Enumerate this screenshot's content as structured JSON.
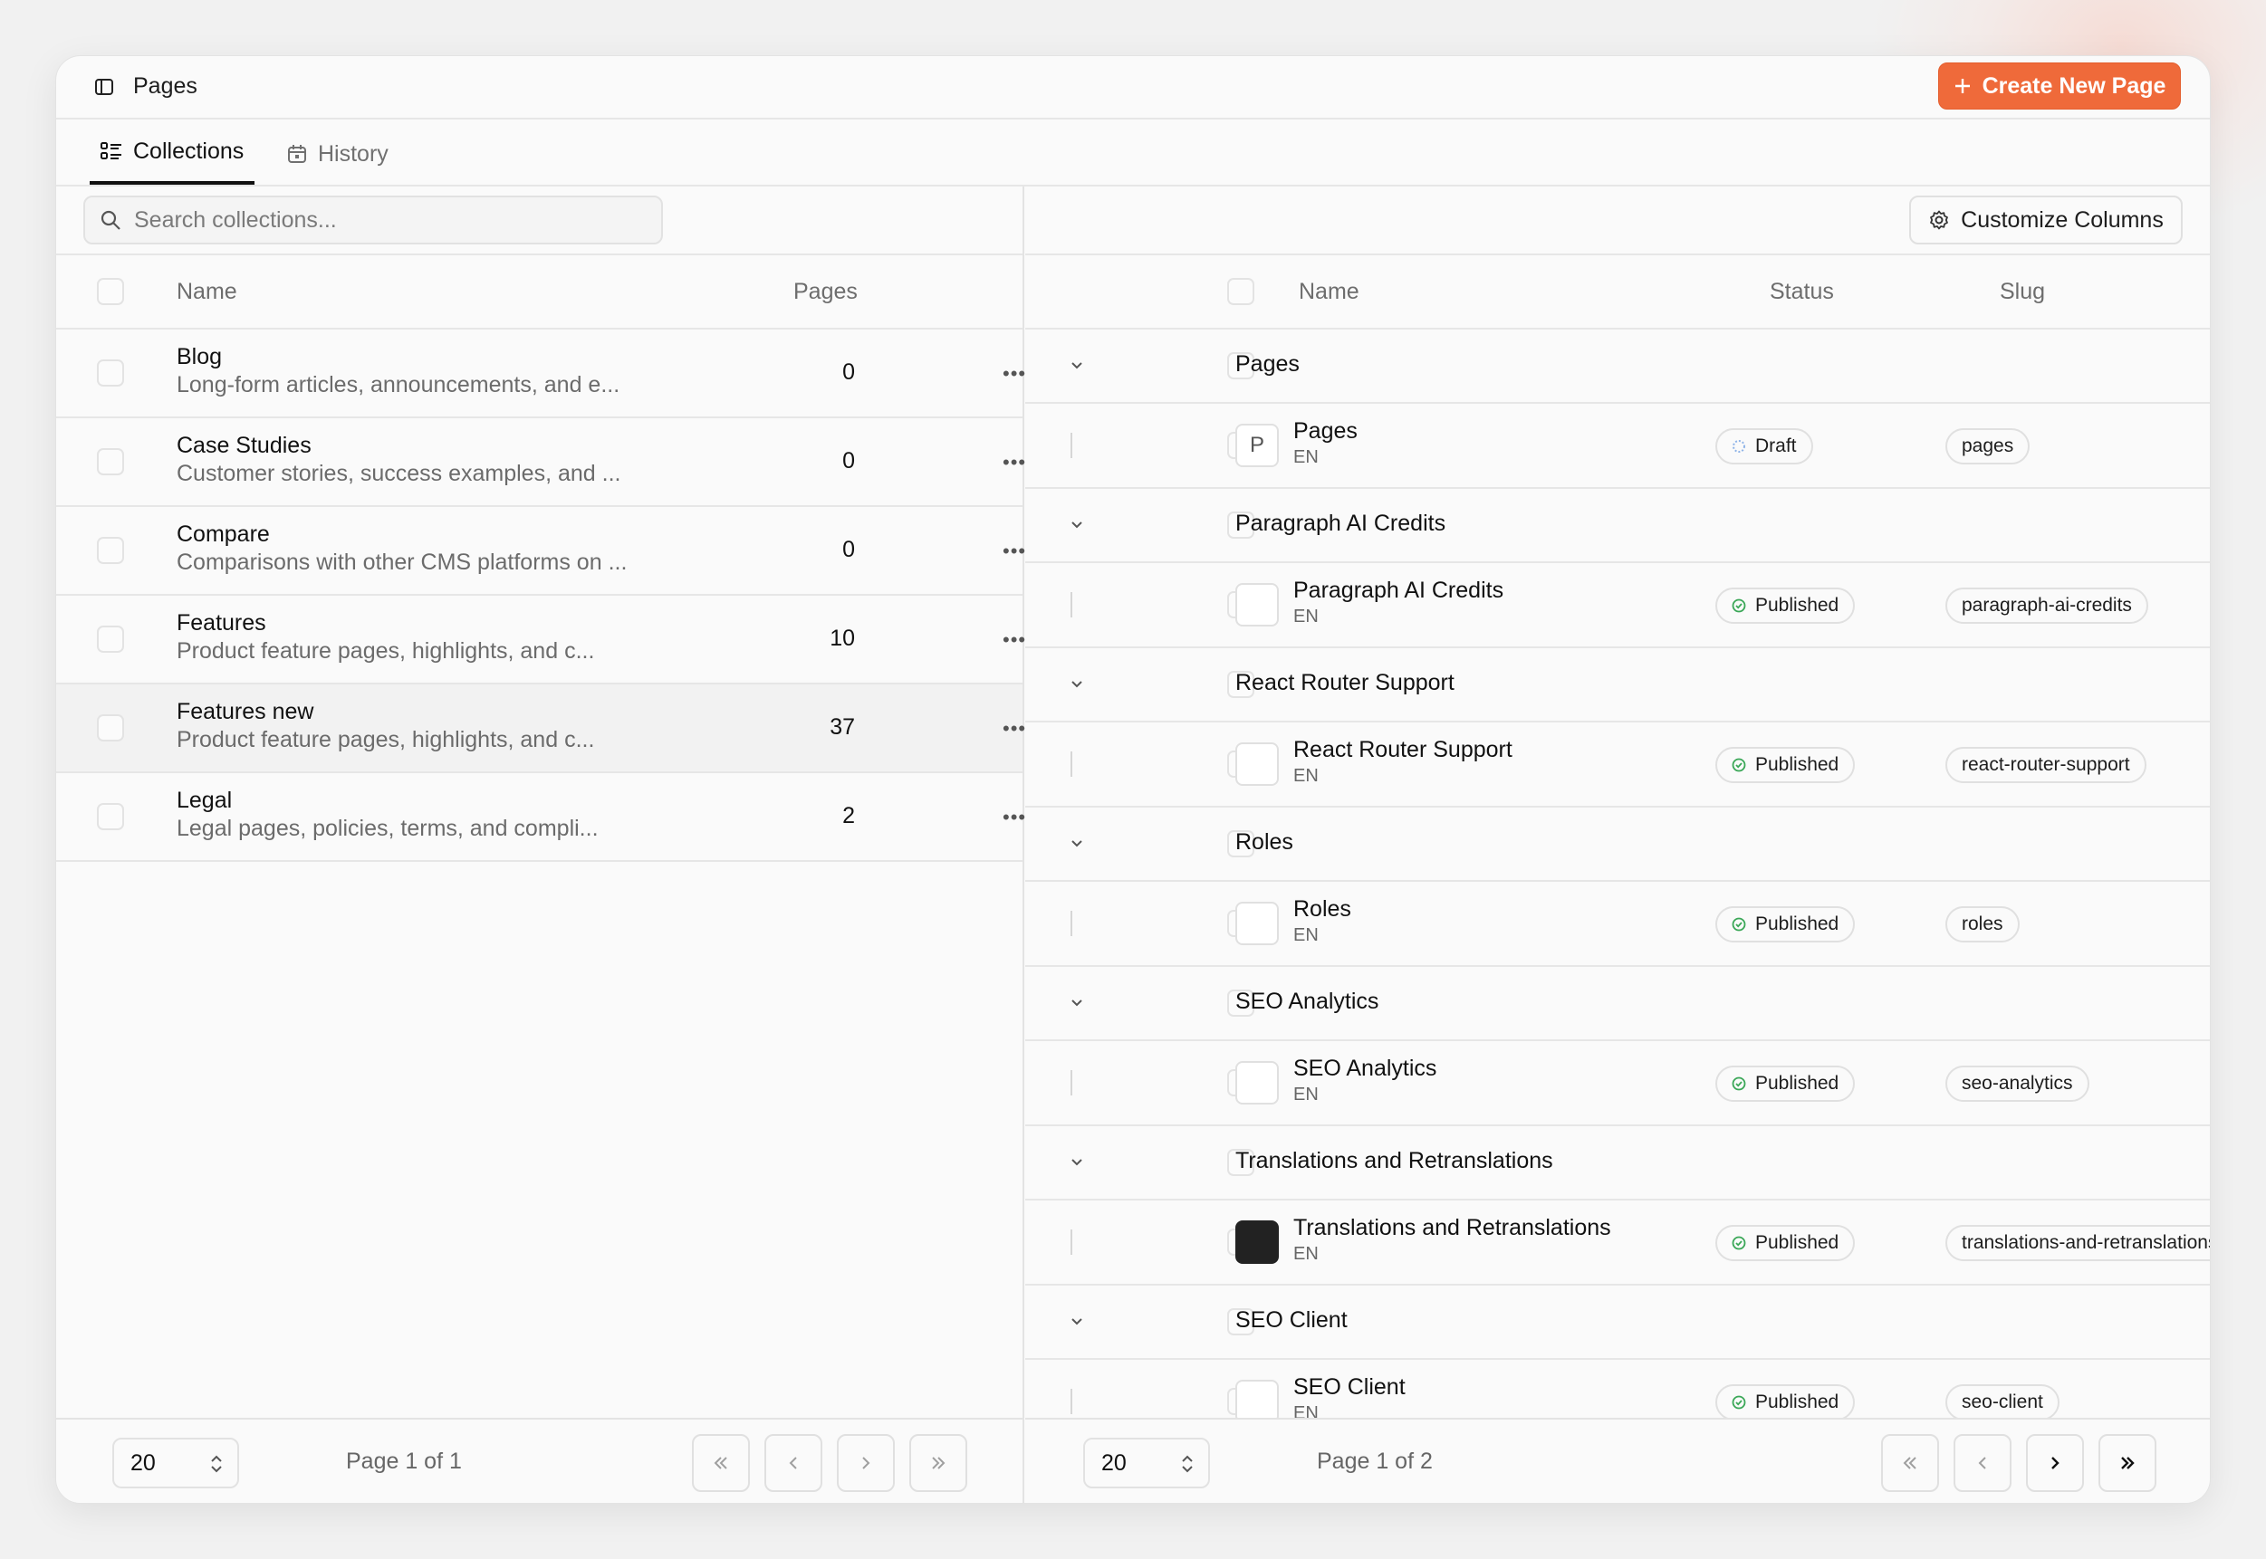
{
  "topbar": {
    "title": "Pages",
    "create_label": "Create New Page"
  },
  "tabs": [
    {
      "label": "Collections"
    },
    {
      "label": "History"
    }
  ],
  "left": {
    "search_placeholder": "Search collections...",
    "columns": {
      "name": "Name",
      "pages": "Pages"
    },
    "rows": [
      {
        "name": "Blog",
        "desc": "Long-form articles, announcements, and e...",
        "count": "0"
      },
      {
        "name": "Case Studies",
        "desc": "Customer stories, success examples, and ...",
        "count": "0"
      },
      {
        "name": "Compare",
        "desc": "Comparisons with other CMS platforms on ...",
        "count": "0"
      },
      {
        "name": "Features",
        "desc": "Product feature pages, highlights, and c...",
        "count": "10"
      },
      {
        "name": "Features new",
        "desc": "Product feature pages, highlights, and c...",
        "count": "37"
      },
      {
        "name": "Legal",
        "desc": "Legal pages, policies, terms, and compli...",
        "count": "2"
      }
    ],
    "footer": {
      "page_size": "20",
      "page_info": "Page 1 of 1"
    }
  },
  "right": {
    "customize_label": "Customize Columns",
    "columns": {
      "name": "Name",
      "status": "Status",
      "slug": "Slug"
    },
    "groups": [
      {
        "group": "Pages",
        "page": {
          "thumb": "P",
          "name": "Pages",
          "lang": "EN",
          "status": "Draft",
          "slug": "pages"
        }
      },
      {
        "group": "Paragraph AI Credits",
        "page": {
          "thumb": "",
          "name": "Paragraph AI Credits",
          "lang": "EN",
          "status": "Published",
          "slug": "paragraph-ai-credits"
        }
      },
      {
        "group": "React Router Support",
        "page": {
          "thumb": "",
          "name": "React Router Support",
          "lang": "EN",
          "status": "Published",
          "slug": "react-router-support"
        }
      },
      {
        "group": "Roles",
        "page": {
          "thumb": "",
          "name": "Roles",
          "lang": "EN",
          "status": "Published",
          "slug": "roles"
        }
      },
      {
        "group": "SEO Analytics",
        "page": {
          "thumb": "",
          "name": "SEO Analytics",
          "lang": "EN",
          "status": "Published",
          "slug": "seo-analytics"
        }
      },
      {
        "group": "Translations and Retranslations",
        "page": {
          "thumb": "",
          "name": "Translations and Retranslations",
          "lang": "EN",
          "status": "Published",
          "slug": "translations-and-retranslations"
        }
      },
      {
        "group": "SEO Client",
        "page": {
          "thumb": "",
          "name": "SEO Client",
          "lang": "EN",
          "status": "Published",
          "slug": "seo-client"
        }
      }
    ],
    "footer": {
      "page_size": "20",
      "page_info": "Page 1 of 2"
    }
  },
  "colors": {
    "accent": "#ef6a3a",
    "published": "#3aa757",
    "draft": "#8fb4e8"
  }
}
